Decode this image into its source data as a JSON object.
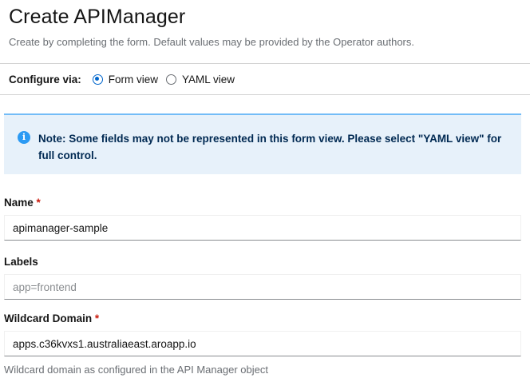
{
  "header": {
    "title": "Create APIManager",
    "subtitle": "Create by completing the form. Default values may be provided by the Operator authors."
  },
  "configure": {
    "label": "Configure via:",
    "options": [
      {
        "label": "Form view",
        "selected": true
      },
      {
        "label": "YAML view",
        "selected": false
      }
    ]
  },
  "alert": {
    "icon": "info-icon",
    "text": "Note: Some fields may not be represented in this form view. Please select \"YAML view\" for full control."
  },
  "fields": {
    "name": {
      "label": "Name",
      "required_marker": "*",
      "value": "apimanager-sample"
    },
    "labels": {
      "label": "Labels",
      "placeholder": "app=frontend",
      "value": ""
    },
    "wildcard_domain": {
      "label": "Wildcard Domain",
      "required_marker": "*",
      "value": "apps.c36kvxs1.australiaeast.aroapp.io",
      "helper": "Wildcard domain as configured in the API Manager object"
    }
  },
  "colors": {
    "accent": "#0066cc",
    "alert_bg": "#e7f1fa",
    "alert_border": "#73bcf7",
    "required": "#c9190b"
  }
}
